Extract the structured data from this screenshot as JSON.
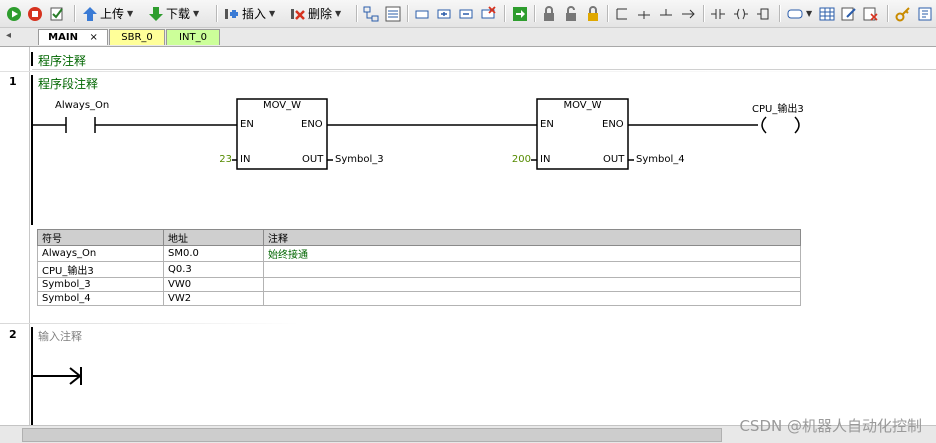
{
  "toolbar": {
    "upload_label": "上传",
    "download_label": "下载",
    "insert_label": "插入",
    "delete_label": "删除"
  },
  "tabs": [
    {
      "label": "MAIN",
      "color": "#ffffff"
    },
    {
      "label": "SBR_0",
      "color": "#ffff99"
    },
    {
      "label": "INT_0",
      "color": "#ccff99"
    }
  ],
  "tab_close_glyph": "×",
  "program_comment": "程序注释",
  "networks": [
    {
      "number": "1",
      "comment": "程序段注释"
    },
    {
      "number": "2",
      "comment": "输入注释"
    }
  ],
  "ladder": {
    "contact_label": "Always_On",
    "block1": {
      "title": "MOV_W",
      "en": "EN",
      "eno": "ENO",
      "in_pin": "IN",
      "out_pin": "OUT",
      "in_value": "23",
      "out_value": "Symbol_3"
    },
    "block2": {
      "title": "MOV_W",
      "en": "EN",
      "eno": "ENO",
      "in_pin": "IN",
      "out_pin": "OUT",
      "in_value": "200",
      "out_value": "Symbol_4"
    },
    "coil_label": "CPU_输出3"
  },
  "symbol_table": {
    "headers": [
      "符号",
      "地址",
      "注释"
    ],
    "rows": [
      [
        "Always_On",
        "SM0.0",
        "始终接通"
      ],
      [
        "CPU_输出3",
        "Q0.3",
        ""
      ],
      [
        "Symbol_3",
        "VW0",
        ""
      ],
      [
        "Symbol_4",
        "VW2",
        ""
      ]
    ]
  },
  "watermark": "CSDN @机器人自动化控制",
  "colors": {
    "comment_green": "#006600",
    "value_green": "#558b00",
    "network2_comment": "#808080"
  }
}
